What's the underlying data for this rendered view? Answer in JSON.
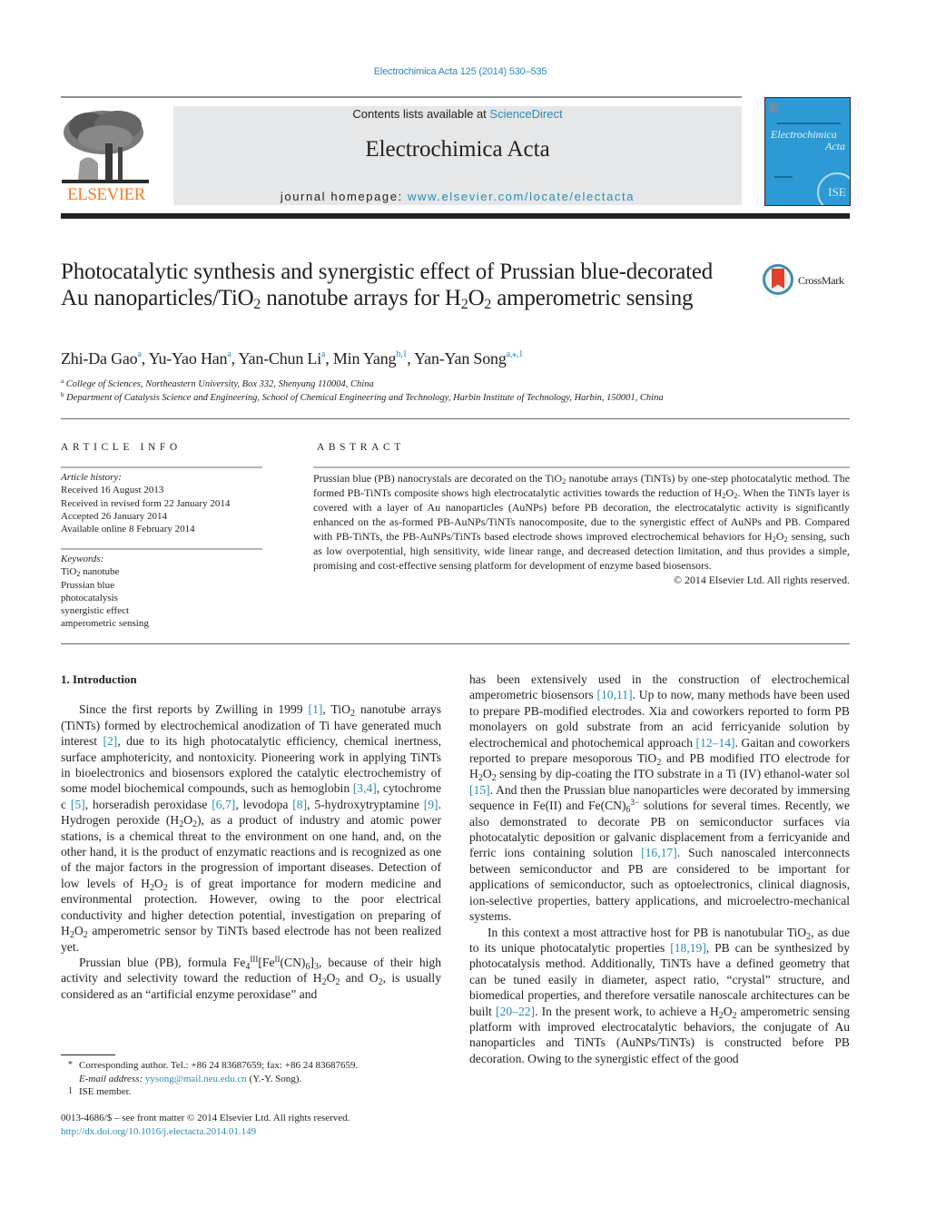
{
  "header": {
    "journal_ref": "Electrochimica Acta 125 (2014) 530–535",
    "contents_prefix": "Contents lists available at ",
    "contents_link": "ScienceDirect",
    "journal_title": "Electrochimica Acta",
    "homepage_prefix": "journal homepage: ",
    "homepage_link": "www.elsevier.com/locate/electacta",
    "publisher": "ELSEVIER",
    "cover_title_1": "Electrochimica",
    "cover_title_2": "Acta",
    "cover_badge": "ISE",
    "colors": {
      "link": "#2a8bb5",
      "elsevier_orange": "#f47b20",
      "cover_blue": "#2d9ad6",
      "band_gray": "#e6e7e8"
    }
  },
  "article": {
    "title_parts": {
      "p1": "Photocatalytic synthesis and synergistic effect of Prussian blue-decorated Au nanoparticles/TiO",
      "s1": "2",
      "p2": " nanotube arrays for H",
      "s2": "2",
      "p3": "O",
      "s3": "2",
      "p4": " amperometric sensing"
    },
    "crossmark": "CrossMark",
    "authors": [
      {
        "name": "Zhi-Da Gao",
        "sup": "a"
      },
      {
        "name": "Yu-Yao Han",
        "sup": "a"
      },
      {
        "name": "Yan-Chun Li",
        "sup": "a"
      },
      {
        "name": "Min Yang",
        "sup": "b,1"
      },
      {
        "name": "Yan-Yan Song",
        "sup": "a,⁎,1"
      }
    ],
    "affiliations": [
      {
        "mark": "a",
        "text": "College of Sciences, Northeastern University, Box 332, Shenyang 110004, China"
      },
      {
        "mark": "b",
        "text": "Department of Catalysis Science and Engineering, School of Chemical Engineering and Technology, Harbin Institute of Technology, Harbin, 150001, China"
      }
    ]
  },
  "article_info": {
    "heading": "ARTICLE INFO",
    "history_label": "Article history:",
    "history": [
      "Received 16 August 2013",
      "Received in revised form 22 January 2014",
      "Accepted 26 January 2014",
      "Available online 8 February 2014"
    ],
    "keywords_label": "Keywords:",
    "keywords": [
      "TiO2 nanotube",
      "Prussian blue",
      "photocatalysis",
      "synergistic effect",
      "amperometric sensing"
    ],
    "kw0_a": "TiO",
    "kw0_sub": "2",
    "kw0_b": " nanotube"
  },
  "abstract": {
    "heading": "ABSTRACT",
    "t1": "Prussian blue (PB) nanocrystals are decorated on the TiO",
    "t2": " nanotube arrays (TiNTs) by one-step photocatalytic method. The formed PB-TiNTs composite shows high electrocatalytic activities towards the reduction of H",
    "t3": "O",
    "t4": ". When the TiNTs layer is covered with a layer of Au nanoparticles (AuNPs) before PB decoration, the electrocatalytic activity is significantly enhanced on the as-formed PB-AuNPs/TiNTs nanocomposite, due to the synergistic effect of AuNPs and PB. Compared with PB-TiNTs, the PB-AuNPs/TiNTs based electrode shows improved electrochemical behaviors for H",
    "t5": "O",
    "t6": " sensing, such as low overpotential, high sensitivity, wide linear range, and decreased detection limitation, and thus provides a simple, promising and cost-effective sensing platform for development of enzyme based biosensors.",
    "sub": "2",
    "copyright": "© 2014 Elsevier Ltd. All rights reserved."
  },
  "body": {
    "section_title": "1.  Introduction",
    "p1": {
      "a": "Since the first reports by Zwilling in 1999 ",
      "r1": "[1]",
      "b": ", TiO",
      "c": " nanotube arrays (TiNTs) formed by electrochemical anodization of Ti have generated much interest ",
      "r2": "[2]",
      "d": ", due to its high photocatalytic efficiency, chemical inertness, surface amphotericity, and nontoxicity. Pioneering work in applying TiNTs in bioelectronics and biosensors explored the catalytic electrochemistry of some model biochemical compounds, such as hemoglobin ",
      "r3": "[3,4]",
      "e": ", cytochrome c ",
      "r4": "[5]",
      "f": ", horseradish peroxidase ",
      "r5": "[6,7]",
      "g": ", levodopa ",
      "r6": "[8]",
      "h": ", 5-hydroxytryptamine ",
      "r7": "[9]",
      "i": ". Hydrogen peroxide (H",
      "j": "O",
      "k": "), as a product of industry and atomic power stations, is a chemical threat to the environment on one hand, and, on the other hand, it is the product of enzymatic reactions and is recognized as one of the major factors in the progression of important diseases. Detection of low levels of H",
      "l": " is of great importance for modern medicine and environmental protection. However, owing to the poor electrical conductivity and higher detection potential, investigation on preparing of H",
      "m": " amperometric sensor by TiNTs based electrode has not been realized yet."
    },
    "p2": {
      "a": "Prussian blue (PB), formula Fe",
      "s4": "4",
      "sIII": "III",
      "b": "[Fe",
      "sII": "II",
      "c": "(CN)",
      "s6": "6",
      "d": "]",
      "s3": "3",
      "e": ", because of their high activity and selectivity toward the reduction of H",
      "f": " and O",
      "g": ", is usually considered as an “artificial enzyme peroxidase” and",
      "cont_a": "has been extensively used in the construction of electrochemical amperometric biosensors ",
      "r1": "[10,11]",
      "cont_b": ". Up to now, many methods have been used to prepare PB-modified electrodes. Xia and coworkers reported to form PB monolayers on gold substrate from an acid ferricyanide solution by electrochemical and photochemical approach ",
      "r2": "[12–14]",
      "cont_c": ". Gaitan and coworkers reported to prepare mesoporous TiO",
      "cont_d": " and PB modified ITO electrode for H",
      "cont_e": " sensing by dip-coating the ITO substrate in a Ti (IV) ethanol-water sol ",
      "r3": "[15]",
      "cont_f": ". And then the Prussian blue nanoparticles were decorated by immersing sequence in Fe(II) and Fe(CN)",
      "charge": "3−",
      "cont_g": " solutions for several times. Recently, we also demonstrated to decorate PB on semiconductor surfaces via photocatalytic deposition or galvanic displacement from a ferricyanide and ferric ions containing solution ",
      "r4": "[16,17]",
      "cont_h": ". Such nanoscaled interconnects between semiconductor and PB are considered to be important for applications of semiconductor, such as optoelectronics, clinical diagnosis, ion-selective properties, battery applications, and microelectro-mechanical systems."
    },
    "p3": {
      "a": "In this context a most attractive host for PB is nanotubular TiO",
      "b": ", as due to its unique photocatalytic properties ",
      "r1": "[18,19]",
      "c": ", PB can be synthesized by photocatalysis method. Additionally, TiNTs have a defined geometry that can be tuned easily in diameter, aspect ratio, “crystal” structure, and biomedical properties, and therefore versatile nanoscale architectures can be built ",
      "r2": "[20–22]",
      "d": ". In the present work, to achieve a H",
      "e": " amperometric sensing platform with improved electrocatalytic behaviors, the conjugate of Au nanoparticles and TiNTs (AuNPs/TiNTs) is constructed before PB decoration. Owing to the synergistic effect of the good"
    },
    "sub2": "2",
    "O": "O",
    "H2O2_a": "H",
    "sub6": "6"
  },
  "footnotes": {
    "star_mark": "*",
    "star_text": "Corresponding author. Tel.: +86 24 83687659; fax: +86 24 83687659.",
    "email_label": "E-mail address: ",
    "email": "yysong@mail.neu.edu.cn",
    "email_suffix": " (Y.-Y. Song).",
    "one_mark": "1",
    "one_text": "ISE member."
  },
  "front_matter": {
    "issn": "0013-4686/$ – see front matter © 2014 Elsevier Ltd. All rights reserved.",
    "doi": "http://dx.doi.org/10.1016/j.electacta.2014.01.149"
  }
}
